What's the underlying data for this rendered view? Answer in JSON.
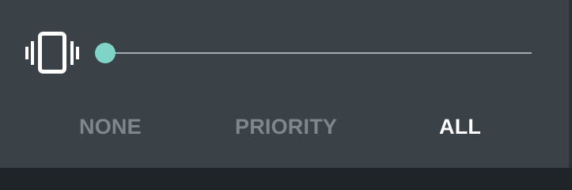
{
  "ringer_panel": {
    "icon": "vibrate-icon",
    "slider": {
      "level": 0.0,
      "accent_color": "#7fd3c7"
    },
    "options": [
      {
        "label": "NONE",
        "selected": false
      },
      {
        "label": "PRIORITY",
        "selected": false
      },
      {
        "label": "ALL",
        "selected": true
      }
    ]
  }
}
